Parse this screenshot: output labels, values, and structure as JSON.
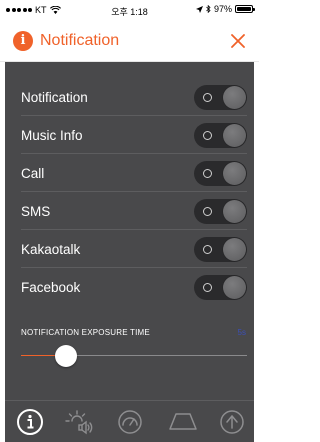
{
  "status_bar": {
    "carrier": "KT",
    "time": "오후 1:18",
    "battery": "97%",
    "battery_level": 0.97
  },
  "header": {
    "title": "Notification",
    "close_label": "X",
    "accent_color": "#f0622a"
  },
  "settings": {
    "items": [
      {
        "label": "Notification",
        "state": "off"
      },
      {
        "label": "Music Info",
        "state": "off"
      },
      {
        "label": "Call",
        "state": "off"
      },
      {
        "label": "SMS",
        "state": "off"
      },
      {
        "label": "Kakaotalk",
        "state": "off"
      },
      {
        "label": "Facebook",
        "state": "off"
      }
    ]
  },
  "exposure": {
    "label": "NOTIFICATION EXPOSURE TIME",
    "value": "5s",
    "slider_fraction": 0.2
  },
  "bottom_nav": {
    "items": [
      {
        "icon": "info-icon",
        "active": true
      },
      {
        "icon": "light-sound-icon",
        "active": false
      },
      {
        "icon": "gauge-icon",
        "active": false
      },
      {
        "icon": "trapezoid-icon",
        "active": false
      },
      {
        "icon": "upload-icon",
        "active": false
      }
    ]
  }
}
